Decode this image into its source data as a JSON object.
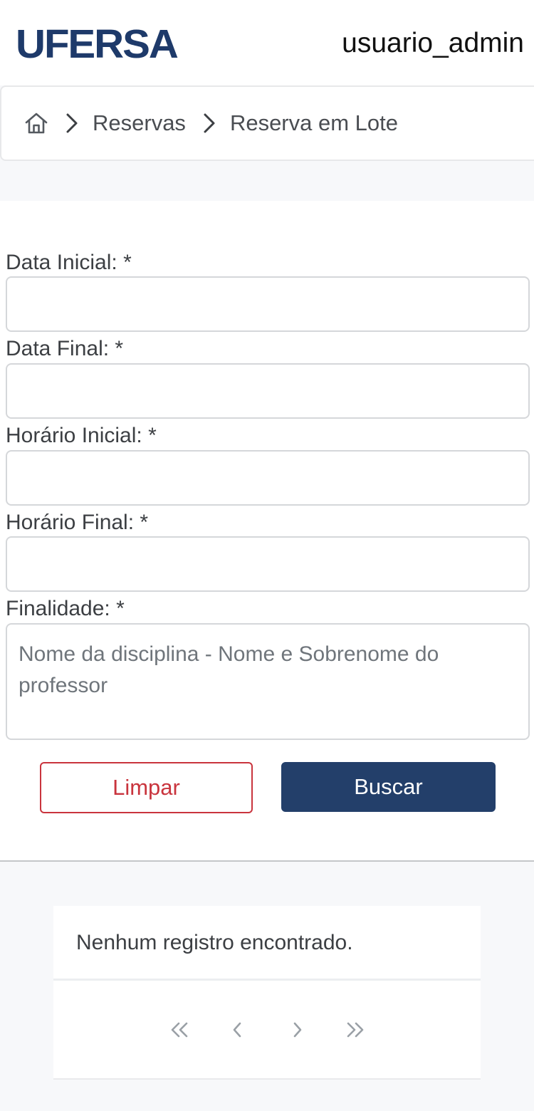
{
  "header": {
    "logo_text": "UFERSA",
    "username": "usuario_admin"
  },
  "breadcrumb": {
    "items": [
      "Reservas",
      "Reserva em Lote"
    ]
  },
  "form": {
    "fields": [
      {
        "label": "Data Inicial: *",
        "value": ""
      },
      {
        "label": "Data Final: *",
        "value": ""
      },
      {
        "label": "Horário Inicial: *",
        "value": ""
      },
      {
        "label": "Horário Final: *",
        "value": ""
      }
    ],
    "finalidade": {
      "label": "Finalidade: *",
      "placeholder": "Nome da disciplina - Nome e Sobrenome do professor"
    },
    "clear_label": "Limpar",
    "search_label": "Buscar"
  },
  "results": {
    "empty_message": "Nenhum registro encontrado."
  },
  "colors": {
    "brand": "#1e3a6a",
    "primary_button": "#233f6a",
    "danger": "#c9343d"
  }
}
